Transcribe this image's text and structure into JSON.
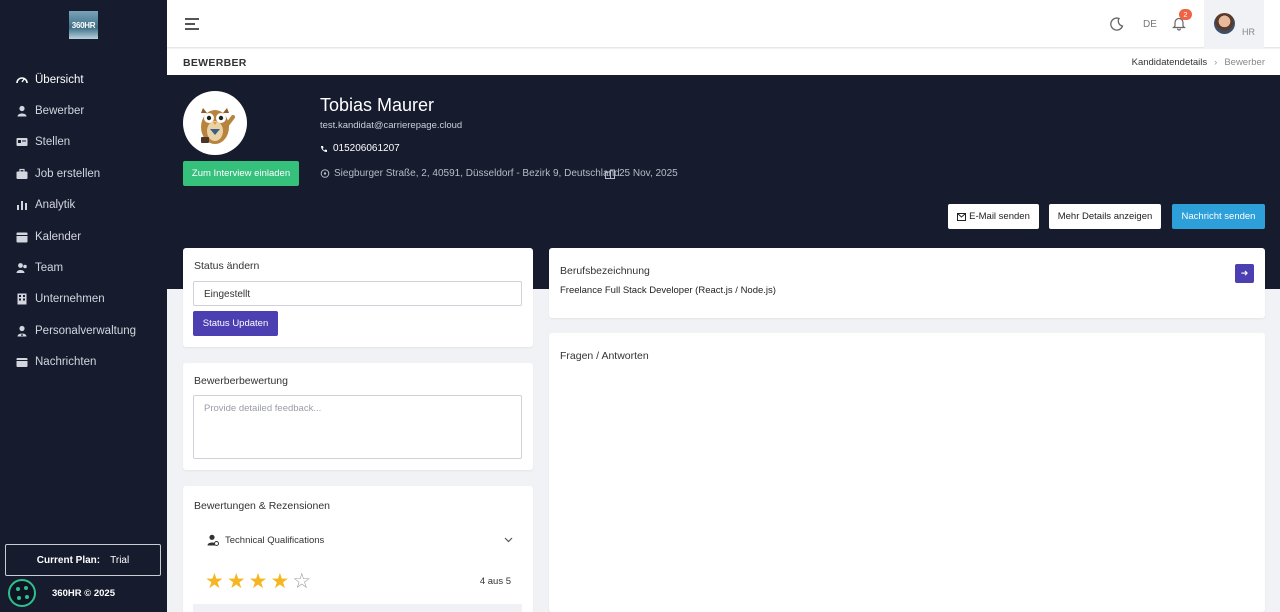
{
  "brand": {
    "logo_text": "360HR"
  },
  "sidebar": {
    "items": [
      {
        "label": "Übersicht",
        "icon": "gauge-icon"
      },
      {
        "label": "Bewerber",
        "icon": "user-icon"
      },
      {
        "label": "Stellen",
        "icon": "id-card-icon"
      },
      {
        "label": "Job erstellen",
        "icon": "briefcase-icon"
      },
      {
        "label": "Analytik",
        "icon": "bar-chart-icon"
      },
      {
        "label": "Kalender",
        "icon": "calendar-icon"
      },
      {
        "label": "Team",
        "icon": "team-icon"
      },
      {
        "label": "Unternehmen",
        "icon": "building-icon"
      },
      {
        "label": "Personalverwaltung",
        "icon": "user-tie-icon"
      },
      {
        "label": "Nachrichten",
        "icon": "message-icon"
      }
    ],
    "plan_label": "Current Plan:",
    "plan_value": "Trial",
    "footer": "360HR © 2025"
  },
  "topbar": {
    "language": "DE",
    "notification_count": "2",
    "user_initials": "HR"
  },
  "page": {
    "title": "BEWERBER",
    "breadcrumb": [
      "Kandidatendetails",
      "Bewerber"
    ]
  },
  "candidate": {
    "name": "Tobias Maurer",
    "email": "test.kandidat@carrierepage.cloud",
    "phone": "015206061207",
    "address": "Siegburger Straße, 2, 40591, Düsseldorf - Bezirk 9, Deutschland",
    "date": "25 Nov, 2025",
    "invite_label": "Zum Interview einladen"
  },
  "actions": {
    "email": "E-Mail senden",
    "details": "Mehr Details anzeigen",
    "message": "Nachricht senden"
  },
  "status": {
    "title": "Status ändern",
    "current": "Eingestellt",
    "button": "Status Updaten"
  },
  "feedback": {
    "title": "Bewerberbewertung",
    "placeholder": "Provide detailed feedback..."
  },
  "reviews": {
    "title": "Bewertungen & Rezensionen",
    "category": "Technical Qualifications",
    "rating": 4,
    "max": 5,
    "score_text": "4 aus 5"
  },
  "job": {
    "title": "Berufsbezeichnung",
    "value": "Freelance Full Stack Developer (React.js / Node.js)"
  },
  "qa": {
    "title": "Fragen / Antworten"
  },
  "colors": {
    "sidebar_bg": "#161b2e",
    "accent_purple": "#4b3fb2",
    "success_green": "#35c07c",
    "info_blue": "#2d9fd9",
    "star_gold": "#f5b621"
  }
}
